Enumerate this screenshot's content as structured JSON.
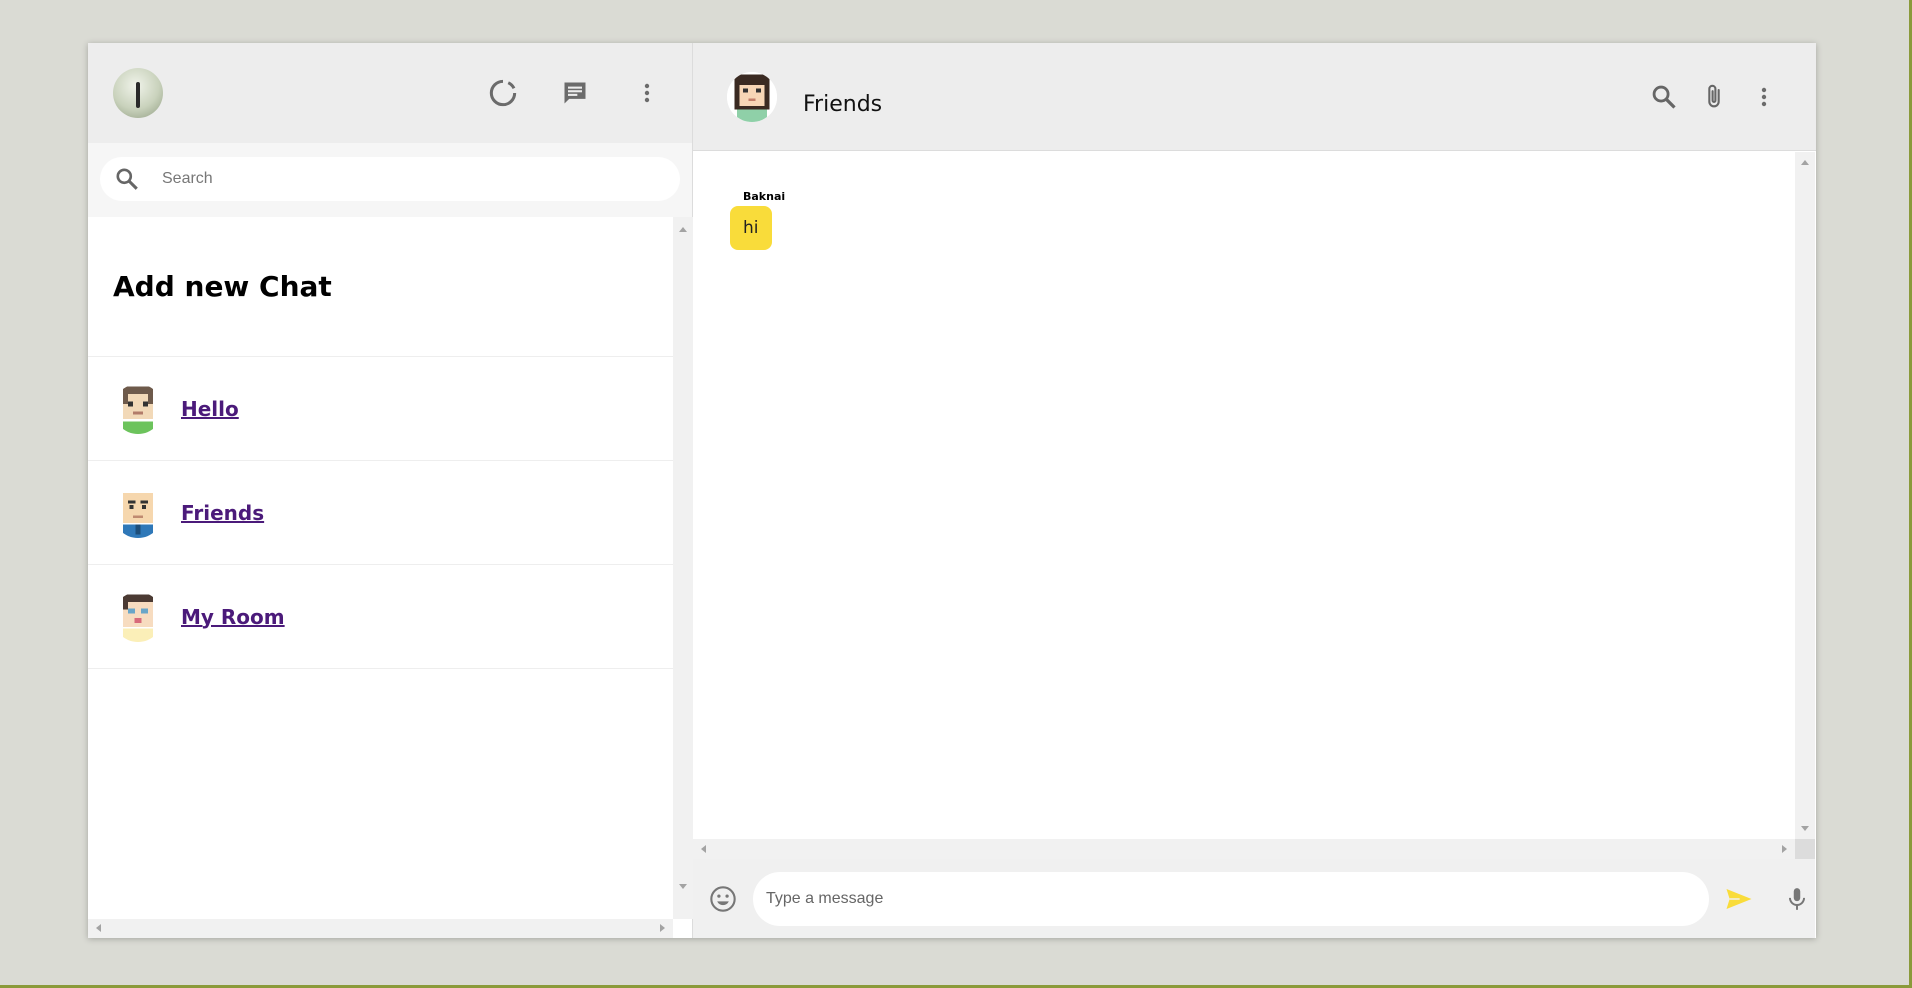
{
  "sidebar": {
    "search": {
      "placeholder": "Search"
    },
    "add_new_chat": "Add new Chat",
    "chats": [
      {
        "name": "Hello"
      },
      {
        "name": "Friends"
      },
      {
        "name": "My Room"
      }
    ]
  },
  "main": {
    "header": {
      "title": "Friends"
    },
    "messages": [
      {
        "sender": "Baknai",
        "text": "hi"
      }
    ],
    "composer": {
      "placeholder": "Type a message"
    }
  },
  "colors": {
    "background": "#dadbd4",
    "panel": "#ededed",
    "bubble": "#f9dc3a",
    "send_icon": "#f9dc3a",
    "link": "#4b1a7a",
    "icon": "#6b6b6b"
  },
  "icons": {
    "status": "refresh-ring-icon",
    "new_chat": "chat-bubble-icon",
    "menu": "more-vertical-icon",
    "search": "search-icon",
    "attach": "paperclip-icon",
    "emoji": "emoji-icon",
    "send": "send-icon",
    "mic": "microphone-icon"
  }
}
